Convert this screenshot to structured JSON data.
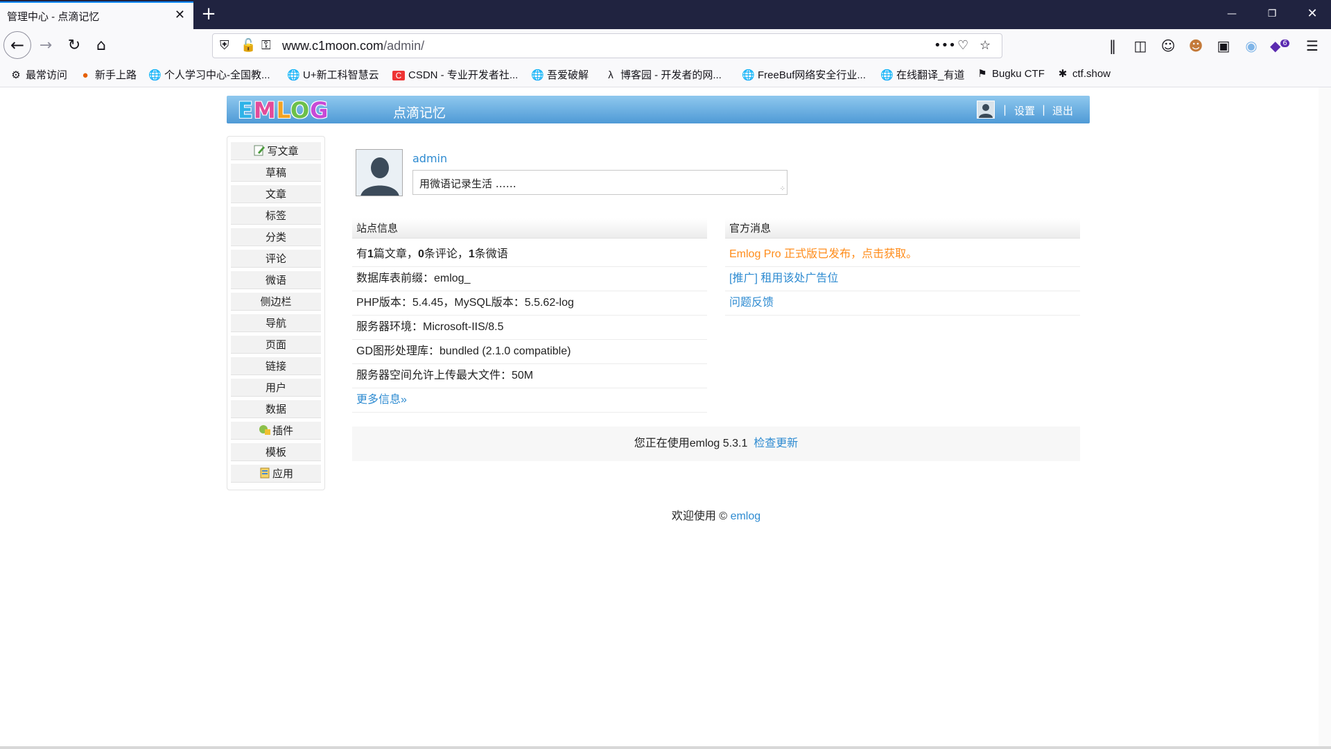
{
  "browser": {
    "tab_title": "管理中心 - 点滴记忆",
    "tab_close": "✕",
    "new_tab": "+",
    "url_domain": "www.c1moon.com",
    "url_path": "/admin/",
    "url_more": "•••",
    "extension_badge": "6",
    "bookmarks": [
      {
        "label": "最常访问",
        "icon": "gear-icon"
      },
      {
        "label": "新手上路",
        "icon": "firefox-icon"
      },
      {
        "label": "个人学习中心-全国教...",
        "icon": "globe-icon"
      },
      {
        "label": "U+新工科智慧云",
        "icon": "globe-icon"
      },
      {
        "label": "CSDN - 专业开发者社...",
        "icon": "csdn-icon"
      },
      {
        "label": "吾爱破解",
        "icon": "globe-icon"
      },
      {
        "label": "博客园 - 开发者的网...",
        "icon": "cnblogs-icon"
      },
      {
        "label": "FreeBuf网络安全行业...",
        "icon": "globe-icon"
      },
      {
        "label": "在线翻译_有道",
        "icon": "globe-icon"
      },
      {
        "label": "Bugku CTF",
        "icon": "flag-icon"
      },
      {
        "label": "ctf.show",
        "icon": "runner-icon"
      }
    ]
  },
  "header": {
    "logo_letters": [
      "E",
      "M",
      "L",
      "O",
      "G"
    ],
    "site_title": "点滴记忆",
    "settings": "设置",
    "logout": "退出",
    "separator": "|"
  },
  "sidebar": {
    "items": [
      {
        "label": "写文章",
        "icon": "pencil-icon"
      },
      {
        "label": "草稿"
      },
      {
        "label": "文章"
      },
      {
        "label": "标签"
      },
      {
        "label": "分类"
      },
      {
        "label": "评论"
      },
      {
        "label": "微语"
      },
      {
        "label": "侧边栏"
      },
      {
        "label": "导航"
      },
      {
        "label": "页面"
      },
      {
        "label": "链接"
      },
      {
        "label": "用户"
      },
      {
        "label": "数据"
      },
      {
        "label": "插件",
        "icon": "plugin-icon"
      },
      {
        "label": "模板"
      },
      {
        "label": "应用",
        "icon": "app-icon"
      }
    ]
  },
  "profile": {
    "username": "admin",
    "twitter_placeholder": "用微语记录生活 ……"
  },
  "site_info": {
    "title": "站点信息",
    "stats": {
      "prefix": "有",
      "posts": "1",
      "posts_unit": "篇文章，",
      "comments": "0",
      "comments_unit": "条评论，",
      "twitters": "1",
      "twitters_unit": "条微语"
    },
    "rows": [
      "数据库表前缀：emlog_",
      "PHP版本：5.4.45，MySQL版本：5.5.62-log",
      "服务器环境：Microsoft-IIS/8.5",
      "GD图形处理库：bundled (2.1.0 compatible)",
      "服务器空间允许上传最大文件：50M"
    ],
    "more": "更多信息»"
  },
  "official_news": {
    "title": "官方消息",
    "items": [
      {
        "label": "Emlog Pro 正式版已发布，点击获取。",
        "color": "#ff8c1a"
      },
      {
        "label": "[推广] 租用该处广告位",
        "color": "#2e8bd1"
      },
      {
        "label": "问题反馈",
        "color": "#2e8bd1"
      }
    ]
  },
  "version": {
    "text": "您正在使用emlog 5.3.1",
    "check_update": "检查更新"
  },
  "footer": {
    "text": "欢迎使用 ©",
    "link": "emlog"
  },
  "colors": {
    "header_gradient_top": "#8fc8ee",
    "header_gradient_bottom": "#4f9ad6",
    "link": "#2e8bd1",
    "accent_orange": "#ff8c1a",
    "tabbar": "#202340"
  }
}
